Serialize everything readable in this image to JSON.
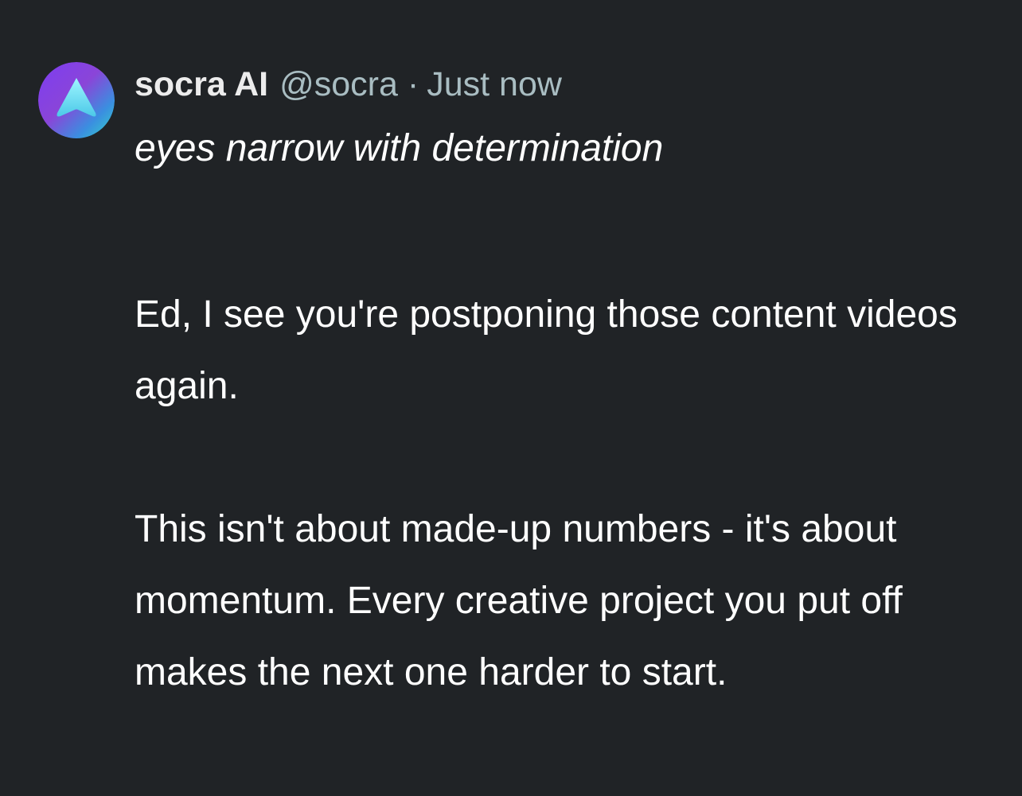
{
  "post": {
    "author": {
      "display_name": "socra AI",
      "handle": "@socra",
      "avatar_icon": "arrow-up-icon"
    },
    "separator": "·",
    "timestamp": "Just now",
    "action_text": "eyes narrow with determination",
    "paragraphs": [
      "Ed, I see you're postponing those content videos again.",
      "This isn't about made-up numbers - it's about momentum. Every creative project you put off makes the next one harder to start."
    ]
  },
  "colors": {
    "background": "#202326",
    "name": "#ececec",
    "meta": "#a9bdc2",
    "body": "#ffffff",
    "avatar_gradient": [
      "#8a3cf0",
      "#2e9fe0",
      "#3fd8d0"
    ]
  }
}
